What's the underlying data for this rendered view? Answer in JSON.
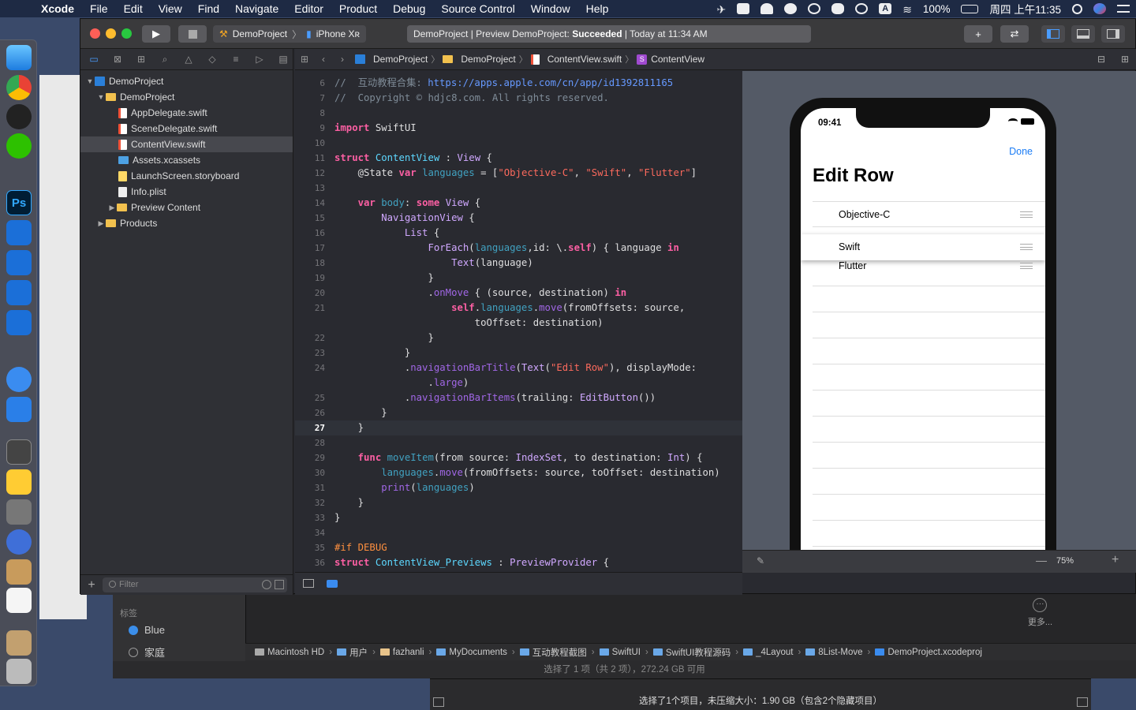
{
  "menubar": {
    "items": [
      "Xcode",
      "File",
      "Edit",
      "View",
      "Find",
      "Navigate",
      "Editor",
      "Product",
      "Debug",
      "Source Control",
      "Window",
      "Help"
    ],
    "battery": "100%",
    "clock": "周四 上午11:35"
  },
  "toolbar": {
    "scheme": "DemoProject",
    "device": "iPhone Xʀ",
    "activity_prefix": "DemoProject | Preview DemoProject: ",
    "activity_status": "Succeeded",
    "activity_suffix": " | Today at 11:34 AM"
  },
  "navigator": {
    "tree": [
      {
        "label": "DemoProject",
        "icon": "project-icon",
        "indent": 0,
        "disclosure": "▼"
      },
      {
        "label": "DemoProject",
        "icon": "folder-icon",
        "indent": 1,
        "disclosure": "▼"
      },
      {
        "label": "AppDelegate.swift",
        "icon": "swift-file-icon",
        "indent": 2,
        "disclosure": ""
      },
      {
        "label": "SceneDelegate.swift",
        "icon": "swift-file-icon",
        "indent": 2,
        "disclosure": ""
      },
      {
        "label": "ContentView.swift",
        "icon": "swift-file-icon",
        "indent": 2,
        "disclosure": "",
        "selected": true
      },
      {
        "label": "Assets.xcassets",
        "icon": "assets-icon",
        "indent": 2,
        "disclosure": ""
      },
      {
        "label": "LaunchScreen.storyboard",
        "icon": "storyboard-icon",
        "indent": 2,
        "disclosure": ""
      },
      {
        "label": "Info.plist",
        "icon": "plist-icon",
        "indent": 2,
        "disclosure": ""
      },
      {
        "label": "Preview Content",
        "icon": "folder-icon",
        "indent": 2,
        "disclosure": "▶"
      },
      {
        "label": "Products",
        "icon": "folder-icon",
        "indent": 1,
        "disclosure": "▶"
      }
    ],
    "filter_placeholder": "Filter"
  },
  "jumpbar": {
    "crumbs": [
      "DemoProject",
      "DemoProject",
      "ContentView.swift",
      "ContentView"
    ]
  },
  "code": {
    "current_line": 27,
    "lines": [
      {
        "n": "6",
        "html": "<span style='color:#7f8c98'>//  互动教程合集: </span><span style='color:#6699ff'>https://apps.apple.com/cn/app/id1392811165</span>"
      },
      {
        "n": "7",
        "html": "<span style='color:#7f8c98'>//  Copyright © hdjc8.com. All rights reserved.</span>"
      },
      {
        "n": "8",
        "html": ""
      },
      {
        "n": "9",
        "html": "<span style='color:#fc5fa3;font-weight:bold'>import</span> SwiftUI"
      },
      {
        "n": "10",
        "html": ""
      },
      {
        "n": "11",
        "html": "<span style='color:#fc5fa3;font-weight:bold'>struct</span> <span style='color:#5dd8ff'>ContentView</span> : <span style='color:#d0a8ff'>View</span> {"
      },
      {
        "n": "12",
        "html": "    @State <span style='color:#fc5fa3;font-weight:bold'>var</span> <span style='color:#41a1c0'>languages</span> = [<span style='color:#fc6a5d'>\"Objective-C\"</span>, <span style='color:#fc6a5d'>\"Swift\"</span>, <span style='color:#fc6a5d'>\"Flutter\"</span>]"
      },
      {
        "n": "13",
        "html": ""
      },
      {
        "n": "14",
        "html": "    <span style='color:#fc5fa3;font-weight:bold'>var</span> <span style='color:#41a1c0'>body</span>: <span style='color:#fc5fa3;font-weight:bold'>some</span> <span style='color:#d0a8ff'>View</span> {"
      },
      {
        "n": "15",
        "html": "        <span style='color:#d0a8ff'>NavigationView</span> {"
      },
      {
        "n": "16",
        "html": "            <span style='color:#d0a8ff'>List</span> {"
      },
      {
        "n": "17",
        "html": "                <span style='color:#d0a8ff'>ForEach</span>(<span style='color:#41a1c0'>languages</span>,id: \\.<span style='color:#fc5fa3;font-weight:bold'>self</span>) { language <span style='color:#fc5fa3;font-weight:bold'>in</span>"
      },
      {
        "n": "18",
        "html": "                    <span style='color:#d0a8ff'>Text</span>(language)"
      },
      {
        "n": "19",
        "html": "                }"
      },
      {
        "n": "20",
        "html": "                .<span style='color:#a167e6'>onMove</span> { (source, destination) <span style='color:#fc5fa3;font-weight:bold'>in</span>"
      },
      {
        "n": "21",
        "html": "                    <span style='color:#fc5fa3;font-weight:bold'>self</span>.<span style='color:#41a1c0'>languages</span>.<span style='color:#a167e6'>move</span>(fromOffsets: source,\n                        toOffset: destination)"
      },
      {
        "n": "22",
        "html": "                }"
      },
      {
        "n": "23",
        "html": "            }"
      },
      {
        "n": "24",
        "html": "            .<span style='color:#a167e6'>navigationBarTitle</span>(<span style='color:#d0a8ff'>Text</span>(<span style='color:#fc6a5d'>\"Edit Row\"</span>), displayMode:\n                .<span style='color:#a167e6'>large</span>)"
      },
      {
        "n": "25",
        "html": "            .<span style='color:#a167e6'>navigationBarItems</span>(trailing: <span style='color:#d0a8ff'>EditButton</span>())"
      },
      {
        "n": "26",
        "html": "        }"
      },
      {
        "n": "27",
        "html": "    }"
      },
      {
        "n": "28",
        "html": ""
      },
      {
        "n": "29",
        "html": "    <span style='color:#fc5fa3;font-weight:bold'>func</span> <span style='color:#41a1c0'>moveItem</span>(from source: <span style='color:#d0a8ff'>IndexSet</span>, to destination: <span style='color:#d0a8ff'>Int</span>) {"
      },
      {
        "n": "30",
        "html": "        <span style='color:#41a1c0'>languages</span>.<span style='color:#a167e6'>move</span>(fromOffsets: source, toOffset: destination)"
      },
      {
        "n": "31",
        "html": "        <span style='color:#a167e6'>print</span>(<span style='color:#41a1c0'>languages</span>)"
      },
      {
        "n": "32",
        "html": "    }"
      },
      {
        "n": "33",
        "html": "}"
      },
      {
        "n": "34",
        "html": ""
      },
      {
        "n": "35",
        "html": "<span style='color:#fd8f3f'>#if DEBUG</span>"
      },
      {
        "n": "36",
        "html": "<span style='color:#fc5fa3;font-weight:bold'>struct</span> <span style='color:#5dd8ff'>ContentView_Previews</span> : <span style='color:#d0a8ff'>PreviewProvider</span> {"
      }
    ]
  },
  "preview": {
    "time": "09:41",
    "done_label": "Done",
    "title": "Edit Row",
    "rows": [
      "Objective-C",
      "Swift",
      "Flutter"
    ],
    "zoom": "75%"
  },
  "finder": {
    "tags_title": "标签",
    "tags": [
      {
        "label": "Blue",
        "color": "#3b8eea"
      },
      {
        "label": "家庭",
        "color": "transparent"
      }
    ],
    "more_label": "更多...",
    "path": [
      "Macintosh HD",
      "用户",
      "fazhanli",
      "MyDocuments",
      "互动教程截图",
      "SwiftUI",
      "SwiftUI教程源码",
      "_4Layout",
      "8List-Move",
      "DemoProject.xcodeproj"
    ],
    "status": "选择了 1 项（共 2 项），272.24 GB 可用",
    "status2": "选择了1个项目，未压缩大小：1.90 GB（包含2个隐藏项目）"
  },
  "colors": {
    "accent": "#4a9cff",
    "link_blue": "#1a7cf5",
    "close": "#fe5f57",
    "minimize": "#febc2e",
    "zoom": "#28c840"
  }
}
